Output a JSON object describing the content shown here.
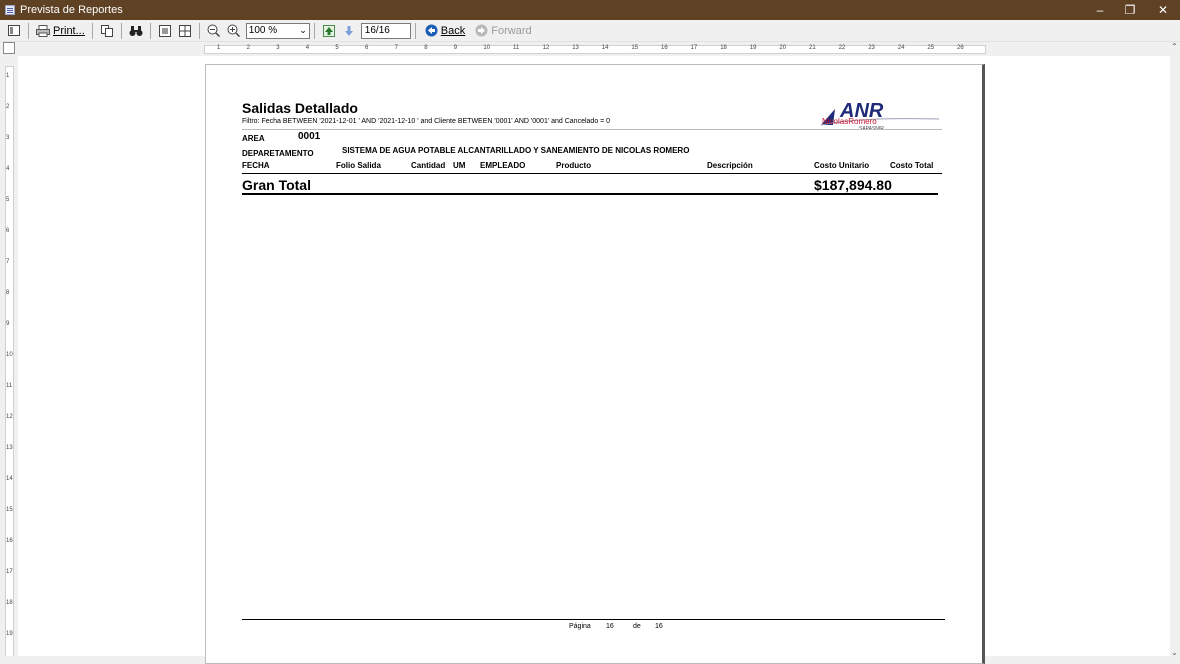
{
  "window": {
    "title": "Prevista de Reportes"
  },
  "toolbar": {
    "print_label": "Print...",
    "zoom_value": "100 %",
    "page_value": "16/16",
    "back_label": "Back",
    "forward_label": "Forward"
  },
  "ruler": {
    "h_ticks": [
      "1",
      "2",
      "3",
      "4",
      "5",
      "6",
      "7",
      "8",
      "9",
      "10",
      "11",
      "12",
      "13",
      "14",
      "15",
      "16",
      "17",
      "18",
      "19",
      "20",
      "21",
      "22",
      "23",
      "24",
      "25",
      "26"
    ],
    "v_ticks": [
      "1",
      "2",
      "3",
      "4",
      "5",
      "6",
      "7",
      "8",
      "9",
      "10",
      "11",
      "12",
      "13",
      "14",
      "15",
      "16",
      "17",
      "18",
      "19"
    ]
  },
  "report": {
    "title": "Salidas Detallado",
    "filter": "Filtro: Fecha BETWEEN '2021-12-01 ' AND '2021-12-10 ' and Cliente BETWEEN '0001' AND '0001' and Cancelado = 0",
    "logo_text": "ANR",
    "logo_sub1": "NicolasRomero",
    "logo_sub2": "SAPASNIR",
    "area_label": "AREA",
    "area_value": "0001",
    "dept_label": "DEPARETAMENTO",
    "dept_value": "SISTEMA DE AGUA POTABLE ALCANTARILLADO Y SANEAMIENTO DE NICOLAS ROMERO",
    "columns": [
      "FECHA",
      "Folio Salida",
      "Cantidad",
      "UM",
      "EMPLEADO",
      "Producto",
      "Descripción",
      "Costo Unitario",
      "Costo Total"
    ],
    "grand_total_label": "Gran Total",
    "grand_total_value": "$187,894.80",
    "footer": {
      "page_label": "Página",
      "page_num": "16",
      "of_label": "de",
      "page_total": "16"
    }
  },
  "colors": {
    "titlebar": "#5f4123",
    "accent_blue": "#1a5fb4",
    "logo_navy": "#1f2a78",
    "logo_red": "#c8102e"
  }
}
